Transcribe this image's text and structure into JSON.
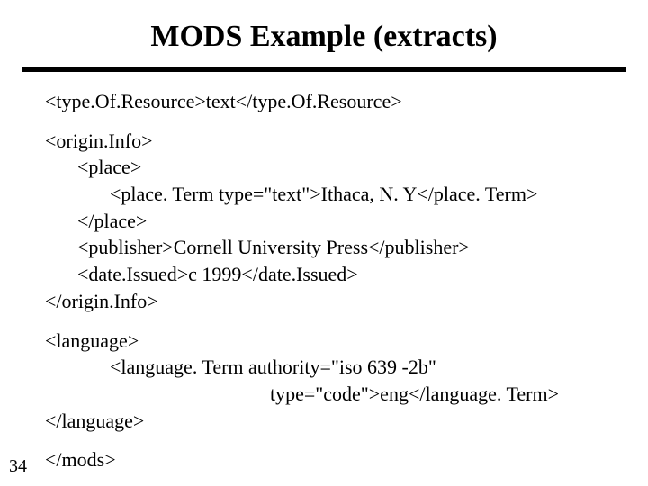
{
  "title": "MODS Example (extracts)",
  "page_number": "34",
  "code": {
    "block1": {
      "l1": "<type.Of.Resource>text</type.Of.Resource>"
    },
    "block2": {
      "l1": "<origin.Info>",
      "l2": "<place>",
      "l3": "<place. Term type=\"text\">Ithaca, N. Y</place. Term>",
      "l4": "</place>",
      "l5": "<publisher>Cornell University Press</publisher>",
      "l6": "<date.Issued>c 1999</date.Issued>",
      "l7": "</origin.Info>"
    },
    "block3": {
      "l1": "<language>",
      "l2": "<language. Term authority=\"iso 639 -2b\"",
      "l3": "type=\"code\">eng</language. Term>",
      "l4": "</language>"
    },
    "block4": {
      "l1": "</mods>"
    }
  }
}
